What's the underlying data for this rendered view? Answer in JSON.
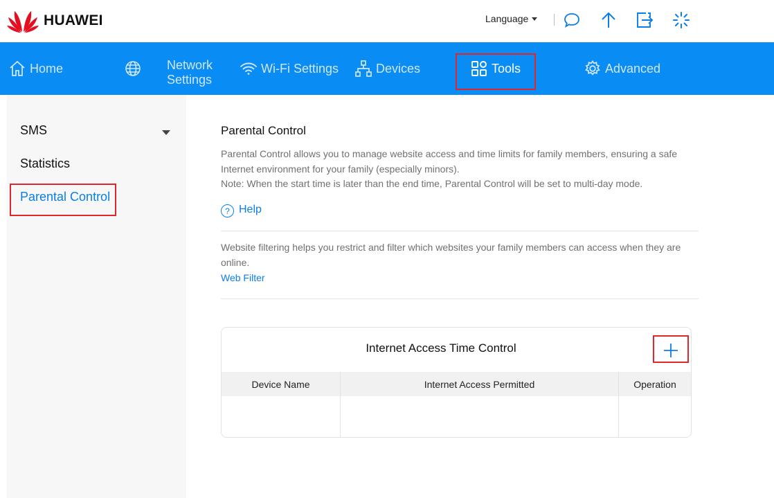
{
  "brand": {
    "name": "HUAWEI"
  },
  "header": {
    "language_label": "Language",
    "icons": [
      "message-icon",
      "upload-icon",
      "logout-icon",
      "loading-icon"
    ]
  },
  "nav": {
    "home": "Home",
    "network_line1": "Network",
    "network_line2": "Settings",
    "wifi": "Wi-Fi Settings",
    "devices": "Devices",
    "tools": "Tools",
    "advanced": "Advanced",
    "active": "Tools"
  },
  "sidebar": {
    "items": [
      {
        "label": "SMS"
      },
      {
        "label": "Statistics"
      },
      {
        "label": "Parental Control"
      }
    ],
    "active": "Parental Control"
  },
  "main": {
    "title": "Parental Control",
    "description_line1": "Parental Control allows you to manage website access and time limits for family members, ensuring a safe Internet environment for your family (especially minors).",
    "note": "Note: When the start time is later than the end time, Parental Control will be set to multi-day mode.",
    "help_label": "Help",
    "filter_description": "Website filtering helps you restrict and filter which websites your family members can access when they are online.",
    "filter_link": "Web Filter",
    "card": {
      "title": "Internet Access Time Control",
      "columns": [
        "Device Name",
        "Internet Access Permitted",
        "Operation"
      ],
      "rows": []
    }
  },
  "colors": {
    "nav_blue": "#0a8cf5",
    "link_blue": "#0a7ee8",
    "highlight_red": "#e0252c",
    "logo_red": "#e40e20"
  }
}
